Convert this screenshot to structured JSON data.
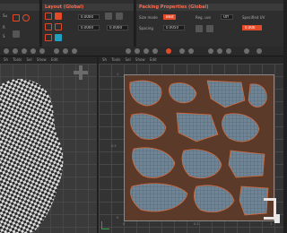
{
  "panels": {
    "layout_title": "Layout (Global)",
    "packing_title": "Packing Properties (Global)"
  },
  "left_panel": {
    "labels": [
      "Su",
      "R",
      "S"
    ]
  },
  "layout": {
    "fields": [
      "0.0000",
      "0.0000",
      "0.0000"
    ]
  },
  "packing": {
    "fields": [
      "Best",
      "0.0050",
      "Off",
      "0.000"
    ],
    "labels": [
      "Size mode",
      "Spacing",
      "Reg. uvs",
      "Specified UV"
    ]
  },
  "view_tabs": [
    "Sh",
    "Tools",
    "Sel",
    "Show",
    "Edit"
  ],
  "colors": {
    "accent": "#ff6a4d",
    "orange": "#e24a2a",
    "uv_bg": "#5b3a2a"
  },
  "ticks_x": [
    "0",
    "0.5",
    "1"
  ],
  "ticks_y": [
    "1",
    "0.5",
    "0"
  ]
}
